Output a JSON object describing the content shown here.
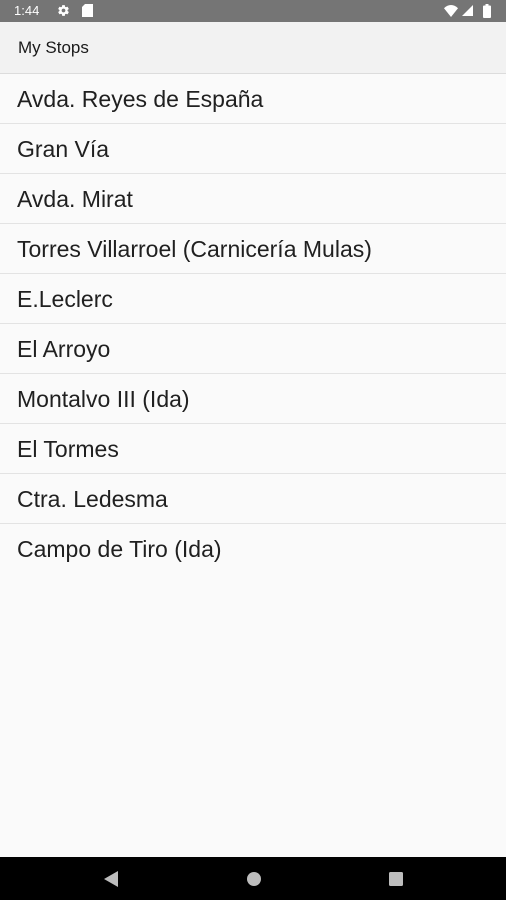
{
  "status_bar": {
    "time": "1:44",
    "icons": [
      "gear-icon",
      "sd-card-icon",
      "wifi-icon",
      "signal-icon",
      "battery-icon"
    ]
  },
  "toolbar": {
    "title": "My Stops"
  },
  "stops": [
    "Avda. Reyes de España",
    "Gran Vía",
    "Avda. Mirat",
    "Torres Villarroel (Carnicería Mulas)",
    "E.Leclerc",
    "El Arroyo",
    "Montalvo III (Ida)",
    "El Tormes",
    "Ctra. Ledesma",
    "Campo de Tiro (Ida)"
  ],
  "nav_bar": {
    "buttons": [
      "back-icon",
      "home-icon",
      "recents-icon"
    ]
  },
  "colors": {
    "status_bar": "#757575",
    "toolbar": "#f2f2f2",
    "background": "#fafafa",
    "nav_bar": "#000000",
    "text": "#202020"
  }
}
